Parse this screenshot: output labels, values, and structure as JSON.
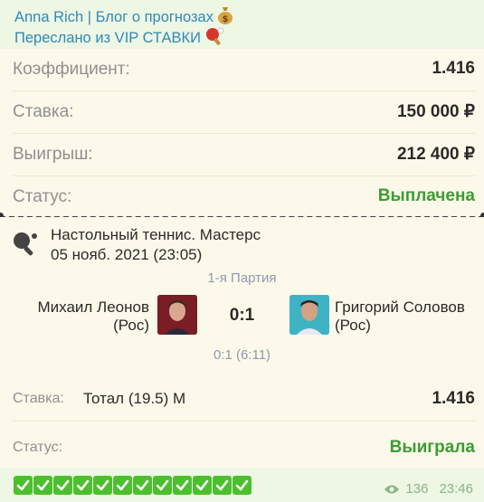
{
  "message": {
    "author": "Anna Rich | Блог о прогнозах",
    "forwarded": "Переслано из VIP СТАВКИ",
    "author_icon": "money-bag-icon",
    "forwarded_icon": "ping-pong-icon"
  },
  "summary": {
    "coef_label": "Коэффициент:",
    "coef_value": "1.416",
    "stake_label": "Ставка:",
    "stake_value": "150 000 ₽",
    "win_label": "Выигрыш:",
    "win_value": "212 400 ₽",
    "status_label": "Статус:",
    "status_value": "Выплачена"
  },
  "event": {
    "title": "Настольный теннис. Мастерс",
    "date": "05 нояб. 2021 (23:05)",
    "period": "1-я Партия",
    "player1_name": "Михаил Леонов",
    "player1_country": "(Рос)",
    "player2_name": "Григорий Соловов",
    "player2_country": "(Рос)",
    "score": "0:1",
    "set_score": "0:1 (6:11)"
  },
  "bet": {
    "stake_label": "Ставка:",
    "market": "Тотал (19.5) М",
    "coef": "1.416",
    "status_label": "Статус:",
    "status_value": "Выиграла"
  },
  "footer": {
    "check_count": 12,
    "views": "136",
    "time": "23:46"
  },
  "colors": {
    "link": "#2f8ab8",
    "win_green": "#3a9e33",
    "label_gray": "#8f8f8f",
    "check_green": "#4cbf2e"
  }
}
